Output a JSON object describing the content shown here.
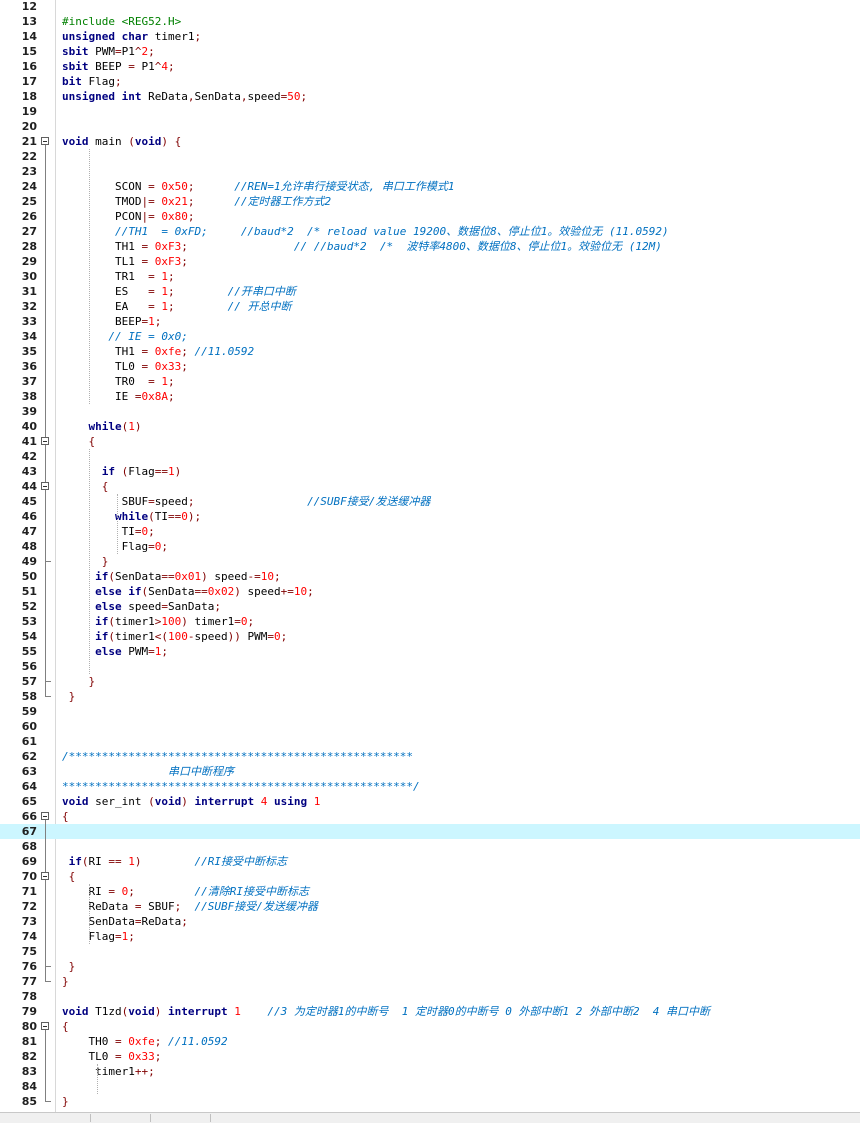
{
  "editor": {
    "first_line_number": 12,
    "current_line": 67,
    "lines": [
      {
        "n": "12",
        "text": ""
      },
      {
        "n": "13",
        "text": "#include <REG52.H>"
      },
      {
        "n": "14",
        "text": "unsigned char timer1;"
      },
      {
        "n": "15",
        "text": "sbit PWM=P1^2;"
      },
      {
        "n": "16",
        "text": "sbit BEEP = P1^4;"
      },
      {
        "n": "17",
        "text": "bit Flag;"
      },
      {
        "n": "18",
        "text": "unsigned int ReData,SenData,speed=50;"
      },
      {
        "n": "19",
        "text": ""
      },
      {
        "n": "20",
        "text": ""
      },
      {
        "n": "21",
        "text": "void main (void) {"
      },
      {
        "n": "22",
        "text": ""
      },
      {
        "n": "23",
        "text": ""
      },
      {
        "n": "24",
        "text": "        SCON = 0x50;      //REN=1允许串行接受状态, 串口工作模式1"
      },
      {
        "n": "25",
        "text": "        TMOD|= 0x21;      //定时器工作方式2"
      },
      {
        "n": "26",
        "text": "        PCON|= 0x80;"
      },
      {
        "n": "27",
        "text": "        //TH1  = 0xFD;     //baud*2  /* reload value 19200、数据位8、停止位1。效验位无 (11.0592)"
      },
      {
        "n": "28",
        "text": "        TH1 = 0xF3;                // //baud*2  /*  波特率4800、数据位8、停止位1。效验位无 (12M)"
      },
      {
        "n": "29",
        "text": "        TL1 = 0xF3;"
      },
      {
        "n": "30",
        "text": "        TR1  = 1;"
      },
      {
        "n": "31",
        "text": "        ES   = 1;        //开串口中断"
      },
      {
        "n": "32",
        "text": "        EA   = 1;        // 开总中断"
      },
      {
        "n": "33",
        "text": "        BEEP=1;"
      },
      {
        "n": "34",
        "text": "       // IE = 0x0;"
      },
      {
        "n": "35",
        "text": "        TH1 = 0xfe; //11.0592"
      },
      {
        "n": "36",
        "text": "        TL0 = 0x33;"
      },
      {
        "n": "37",
        "text": "        TR0  = 1;"
      },
      {
        "n": "38",
        "text": "        IE =0x8A;"
      },
      {
        "n": "39",
        "text": ""
      },
      {
        "n": "40",
        "text": "    while(1)"
      },
      {
        "n": "41",
        "text": "    {"
      },
      {
        "n": "42",
        "text": ""
      },
      {
        "n": "43",
        "text": "      if (Flag==1)"
      },
      {
        "n": "44",
        "text": "      {"
      },
      {
        "n": "45",
        "text": "         SBUF=speed;                 //SUBF接受/发送缓冲器"
      },
      {
        "n": "46",
        "text": "        while(TI==0);"
      },
      {
        "n": "47",
        "text": "         TI=0;"
      },
      {
        "n": "48",
        "text": "         Flag=0;"
      },
      {
        "n": "49",
        "text": "      }"
      },
      {
        "n": "50",
        "text": "     if(SenData==0x01) speed-=10;"
      },
      {
        "n": "51",
        "text": "     else if(SenData==0x02) speed+=10;"
      },
      {
        "n": "52",
        "text": "     else speed=SanData;"
      },
      {
        "n": "53",
        "text": "     if(timer1>100) timer1=0;"
      },
      {
        "n": "54",
        "text": "     if(timer1<(100-speed)) PWM=0;"
      },
      {
        "n": "55",
        "text": "     else PWM=1;"
      },
      {
        "n": "56",
        "text": ""
      },
      {
        "n": "57",
        "text": "    }"
      },
      {
        "n": "58",
        "text": " }"
      },
      {
        "n": "59",
        "text": ""
      },
      {
        "n": "60",
        "text": ""
      },
      {
        "n": "61",
        "text": ""
      },
      {
        "n": "62",
        "text": "/****************************************************"
      },
      {
        "n": "63",
        "text": "                串口中断程序"
      },
      {
        "n": "64",
        "text": "*****************************************************/"
      },
      {
        "n": "65",
        "text": "void ser_int (void) interrupt 4 using 1"
      },
      {
        "n": "66",
        "text": "{"
      },
      {
        "n": "67",
        "text": ""
      },
      {
        "n": "68",
        "text": ""
      },
      {
        "n": "69",
        "text": " if(RI == 1)        //RI接受中断标志"
      },
      {
        "n": "70",
        "text": " {"
      },
      {
        "n": "71",
        "text": "    RI = 0;         //清除RI接受中断标志"
      },
      {
        "n": "72",
        "text": "    ReData = SBUF;  //SUBF接受/发送缓冲器"
      },
      {
        "n": "73",
        "text": "    SenData=ReData;"
      },
      {
        "n": "74",
        "text": "    Flag=1;"
      },
      {
        "n": "75",
        "text": ""
      },
      {
        "n": "76",
        "text": " }"
      },
      {
        "n": "77",
        "text": "}"
      },
      {
        "n": "78",
        "text": ""
      },
      {
        "n": "79",
        "text": "void T1zd(void) interrupt 1    //3 为定时器1的中断号  1 定时器0的中断号 0 外部中断1 2 外部中断2  4 串口中断"
      },
      {
        "n": "80",
        "text": "{"
      },
      {
        "n": "81",
        "text": "    TH0 = 0xfe; //11.0592"
      },
      {
        "n": "82",
        "text": "    TL0 = 0x33;"
      },
      {
        "n": "83",
        "text": "     timer1++;"
      },
      {
        "n": "84",
        "text": ""
      },
      {
        "n": "85",
        "text": "}"
      }
    ]
  }
}
